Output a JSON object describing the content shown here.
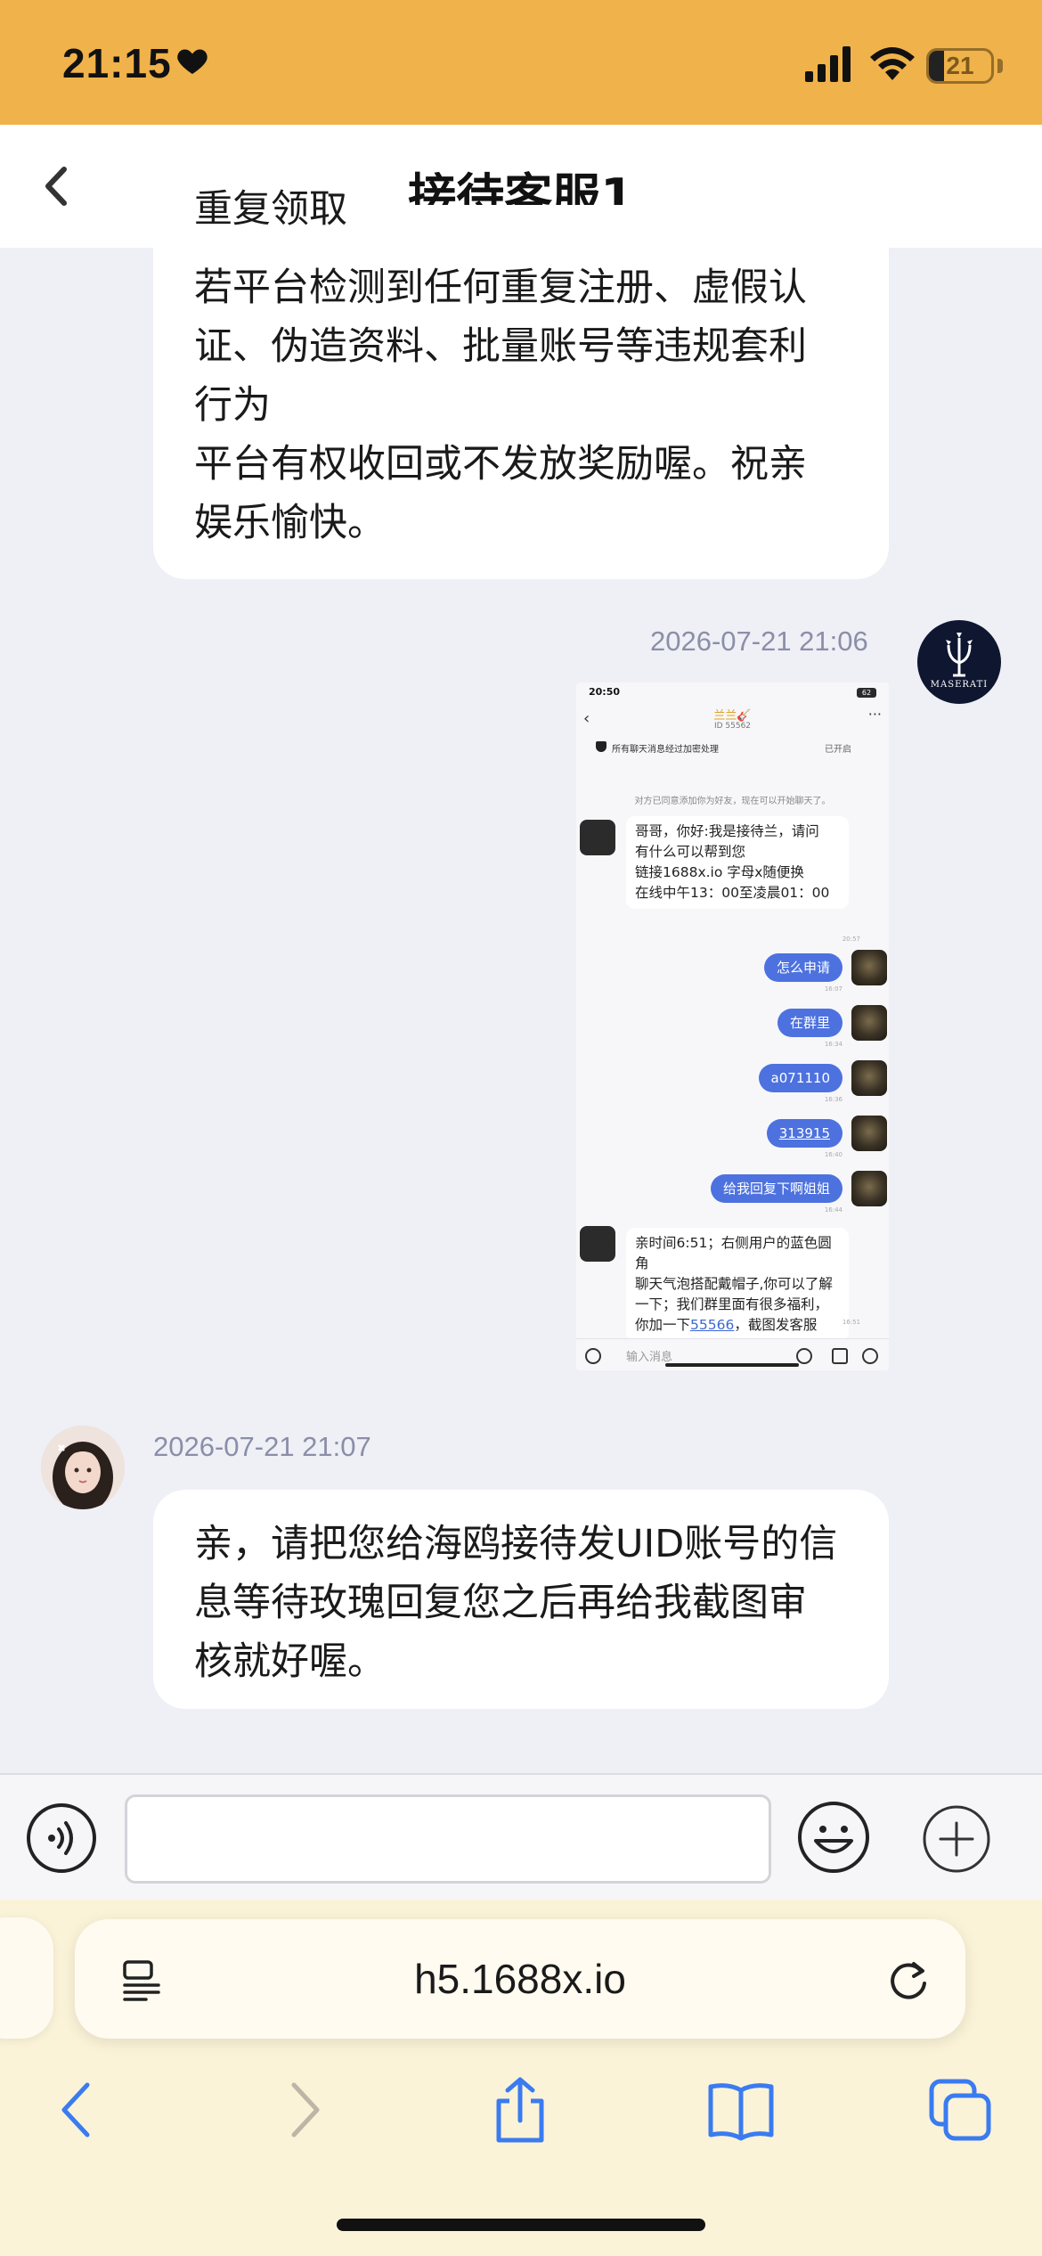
{
  "status_bar": {
    "time": "21:15",
    "battery": "21"
  },
  "header": {
    "title": "接待客服1"
  },
  "messages": {
    "top_cut_line": "重复领取",
    "top_text": "若平台检测到任何重复注册、虚假认\n证、伪造资料、批量账号等违规套利\n行为\n平台有权收回或不发放奖励喔。祝亲\n娱乐愉快。",
    "user_timestamp": "2026-07-21 21:06",
    "agent_timestamp": "2026-07-21 21:07",
    "agent_text": "亲，请把您给海鸥接待发UID账号的信\n息等待玫瑰回复您之后再给我截图审\n核就好喔。",
    "maserati_label": "MASERATI"
  },
  "screenshot": {
    "time": "20:50",
    "battery": "62",
    "contact_name": "兰兰🎸",
    "contact_id": "ID 55562",
    "encryption_note": "所有聊天消息经过加密处理",
    "encryption_status": "已开启",
    "system_note": "对方已同意添加你为好友，现在可以开始聊天了。",
    "msg1": "哥哥，你好:我是接待兰，请问\n有什么可以帮到您\n链接1688x.io 字母x随便换\n在线中午13：00至凌晨01：00",
    "msg1_time": "20:57",
    "replies": [
      {
        "text": "怎么申请",
        "time": "16:07"
      },
      {
        "text": "在群里",
        "time": "16:34"
      },
      {
        "text": "a071110",
        "time": "16:36"
      },
      {
        "text": "313915",
        "time": "16:40"
      },
      {
        "text": "给我回复下啊姐姐",
        "time": "16:44"
      }
    ],
    "msg2_before": "亲时间6:51；右侧用户的蓝色圆角\n聊天气泡搭配戴帽子,你可以了解\n一下；我们群里面有很多福利，\n你加一下",
    "msg2_link": "55566",
    "msg2_after": "，截图发客服",
    "msg2_time": "16:51",
    "input_placeholder": "输入消息"
  },
  "input": {
    "value": ""
  },
  "browser": {
    "url": "h5.1688x.io"
  },
  "colors": {
    "status_bar": "#f0b24a",
    "chat_bg": "#efeff6",
    "browser_bg": "#fbf3d8",
    "reply_bubble": "#4d72df",
    "timestamp": "#8a8fa8"
  }
}
